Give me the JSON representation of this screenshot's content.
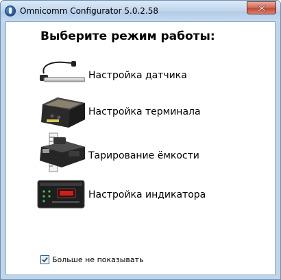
{
  "window": {
    "title": "Omnicomm Configurator 5.0.2.58",
    "close_icon": "close-icon",
    "app_icon": "omnicomm-app-icon"
  },
  "heading": "Выберите режим работы:",
  "options": [
    {
      "label": "Настройка датчика",
      "icon": "fuel-sensor-icon"
    },
    {
      "label": "Настройка терминала",
      "icon": "terminal-device-icon"
    },
    {
      "label": "Тарирование ёмкости",
      "icon": "tank-calibration-icon"
    },
    {
      "label": "Настройка индикатора",
      "icon": "indicator-display-icon"
    }
  ],
  "dont_show_again": {
    "label": "Больше не показывать",
    "checked": true
  },
  "colors": {
    "title_bar": "#c3d8ee",
    "close_button": "#c24a35",
    "window_border": "#6d8fb3",
    "checkbox_check": "#1c5180"
  }
}
